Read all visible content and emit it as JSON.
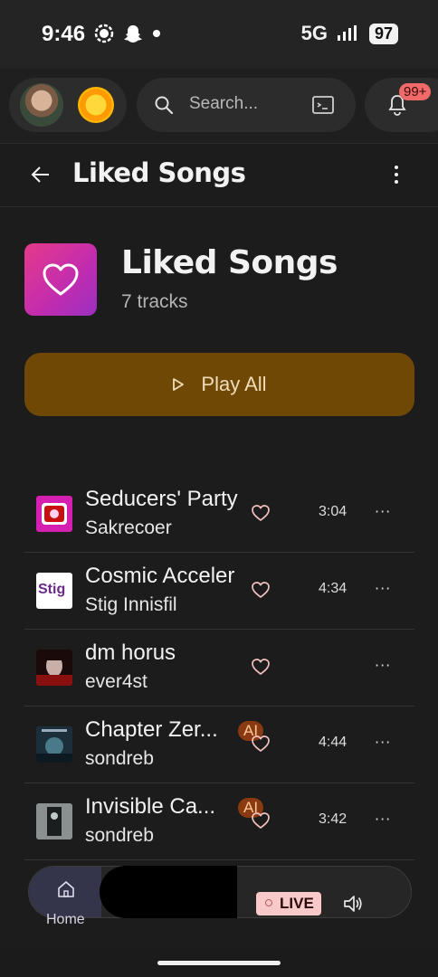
{
  "status_bar": {
    "time": "9:46",
    "network": "5G",
    "battery": "97"
  },
  "top_bar": {
    "search_placeholder": "Search...",
    "notification_badge": "99+"
  },
  "header": {
    "title": "Liked Songs"
  },
  "playlist": {
    "title": "Liked Songs",
    "track_count": "7 tracks",
    "play_all_label": "Play All"
  },
  "tracks": [
    {
      "title": "Seducers' Party",
      "artist": "Sakrecoer",
      "duration": "3:04",
      "ai": "",
      "more": "···",
      "thumb_color": "#d41fb0"
    },
    {
      "title": "Cosmic Acceler",
      "artist": "Stig Innisfil",
      "duration": "4:34",
      "ai": "",
      "more": "···",
      "thumb_color": "#ffffff"
    },
    {
      "title": "dm horus",
      "artist": "ever4st",
      "duration": "",
      "ai": "",
      "more": "···",
      "thumb_color": "#7a1010"
    },
    {
      "title": "Chapter Zer...",
      "artist": "sondreb",
      "duration": "4:44",
      "ai": "AI",
      "more": "···",
      "thumb_color": "#2a4a5a"
    },
    {
      "title": "Invisible Ca...",
      "artist": "sondreb",
      "duration": "3:42",
      "ai": "AI",
      "more": "···",
      "thumb_color": "#5a6060"
    }
  ],
  "thumb_text": {
    "stig": "Stig"
  },
  "player": {
    "home_label": "Home",
    "live_label": "LIVE"
  },
  "colors": {
    "accent_play": "#704806",
    "cover_gradient_start": "#e63a8a",
    "badge": "#f06a6a"
  }
}
